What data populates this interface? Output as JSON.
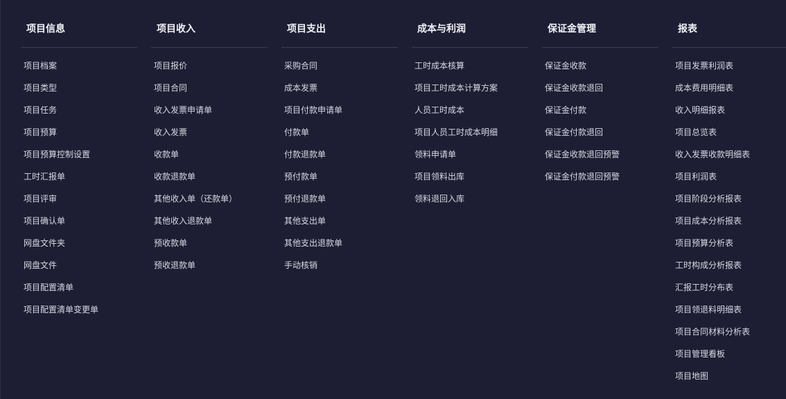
{
  "menu": {
    "columns": [
      {
        "title": "项目信息",
        "items": [
          "项目档案",
          "项目类型",
          "项目任务",
          "项目预算",
          "项目预算控制设置",
          "工时汇报单",
          "项目评审",
          "项目确认单",
          "网盘文件夹",
          "网盘文件",
          "项目配置清单",
          "项目配置清单变更单"
        ]
      },
      {
        "title": "项目收入",
        "items": [
          "项目报价",
          "项目合同",
          "收入发票申请单",
          "收入发票",
          "收款单",
          "收款退款单",
          "其他收入单（还款单）",
          "其他收入退款单",
          "预收款单",
          "预收退款单"
        ]
      },
      {
        "title": "项目支出",
        "items": [
          "采购合同",
          "成本发票",
          "项目付款申请单",
          "付款单",
          "付款退款单",
          "预付款单",
          "预付退款单",
          "其他支出单",
          "其他支出退款单",
          "手动核销"
        ]
      },
      {
        "title": "成本与利润",
        "items": [
          "工时成本核算",
          "项目工时成本计算方案",
          "人员工时成本",
          "项目人员工时成本明细",
          "领料申请单",
          "项目领料出库",
          "领料退回入库"
        ]
      },
      {
        "title": "保证金管理",
        "items": [
          "保证金收款",
          "保证金收款退回",
          "保证金付款",
          "保证金付款退回",
          "保证金收款退回预警",
          "保证金付款退回预警"
        ]
      },
      {
        "title": "报表",
        "items": [
          "项目发票利润表",
          "成本费用明细表",
          "收入明细报表",
          "项目总览表",
          "收入发票收款明细表",
          "项目利润表",
          "项目阶段分析报表",
          "项目成本分析报表",
          "项目预算分析表",
          "工时构成分析报表",
          "汇报工时分布表",
          "项目领退料明细表",
          "项目合同材料分析表",
          "项目管理看板",
          "项目地图"
        ]
      }
    ]
  },
  "colors": {
    "background": "#1d1e33",
    "title": "#f1f2f7",
    "item": "#d7d9e4",
    "divider": "#3a3c58"
  }
}
